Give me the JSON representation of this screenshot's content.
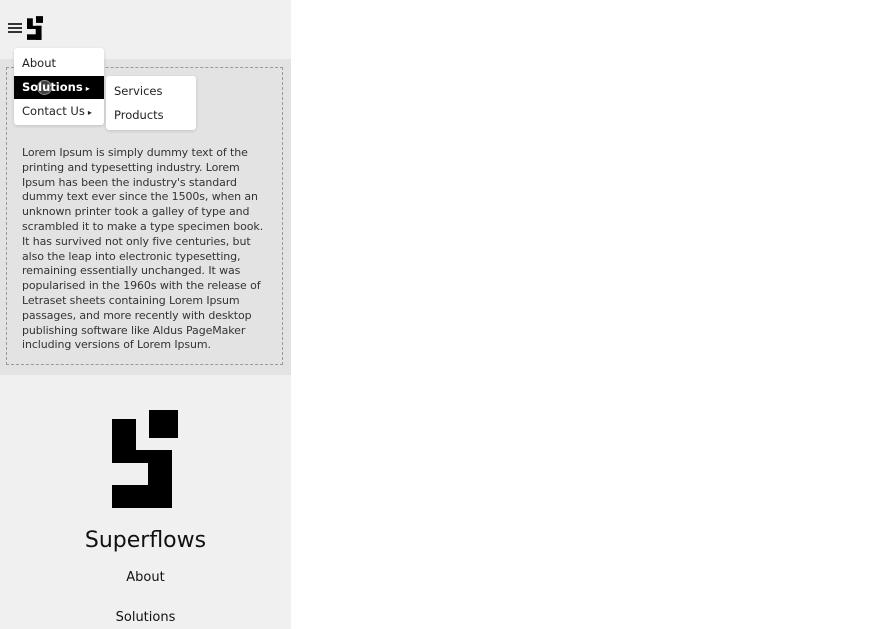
{
  "header": {
    "menu_icon": "hamburger-menu-icon",
    "logo_icon": "superflows-logo-icon"
  },
  "dropdown": {
    "items": [
      {
        "label": "About",
        "has_submenu": false
      },
      {
        "label": "Solutions",
        "has_submenu": true,
        "arrow": "▸"
      },
      {
        "label": "Contact Us",
        "has_submenu": true,
        "arrow": "▸"
      }
    ],
    "submenu": {
      "items": [
        {
          "label": "Services"
        },
        {
          "label": "Products"
        }
      ]
    }
  },
  "hero": {
    "body": "Lorem Ipsum is simply dummy text of the printing and typesetting industry. Lorem Ipsum has been the industry's standard dummy text ever since the 1500s, when an unknown printer took a galley of type and scrambled it to make a type specimen book. It has survived not only five centuries, but also the leap into electronic typesetting, remaining essentially unchanged. It was popularised in the 1960s with the release of Letraset sheets containing Lorem Ipsum passages, and more recently with desktop publishing software like Aldus PageMaker including versions of Lorem Ipsum."
  },
  "footer": {
    "brand": "Superflows",
    "links": [
      {
        "label": "About"
      },
      {
        "label": "Solutions"
      }
    ]
  },
  "colors": {
    "background": "#f0f0f0",
    "hero_background": "#e3e3e3",
    "active_item": "#000000",
    "logo": "#000000"
  }
}
